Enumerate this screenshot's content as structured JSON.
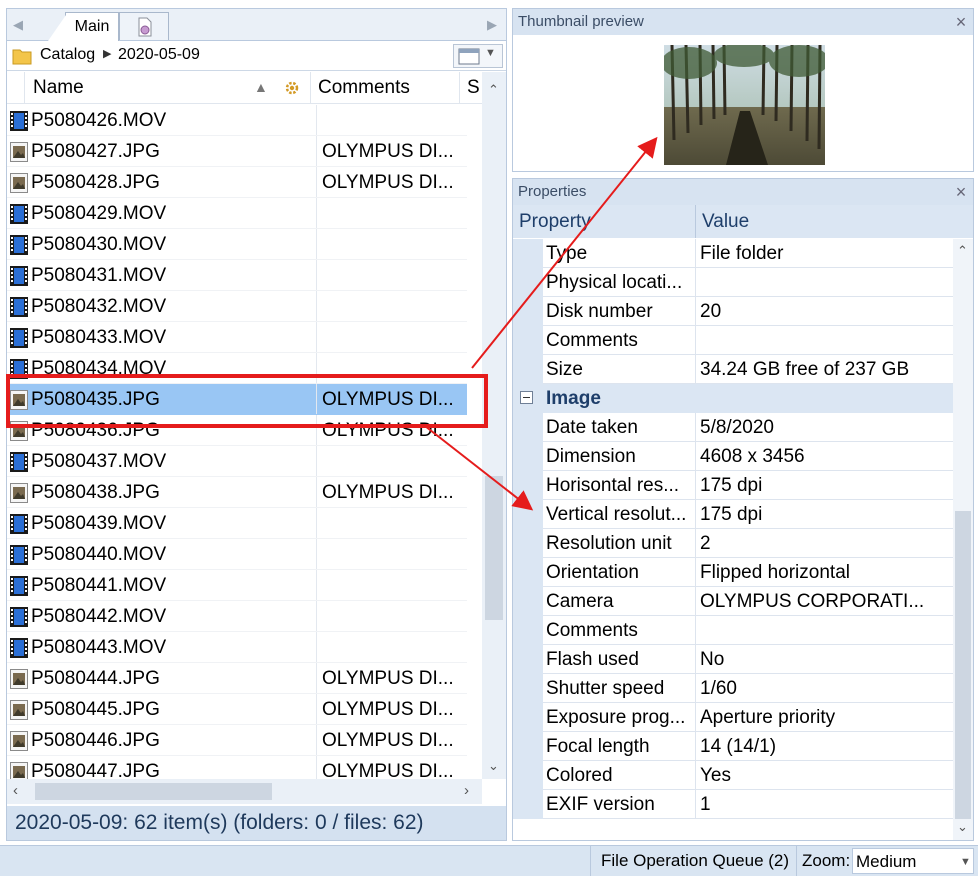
{
  "tabs": {
    "main_label": "Main"
  },
  "breadcrumb": {
    "root": "Catalog",
    "folder": "2020-05-09"
  },
  "columns": {
    "name": "Name",
    "comments": "Comments",
    "size_short": "S"
  },
  "files": [
    {
      "name": "P5080426.MOV",
      "type": "video",
      "comment": ""
    },
    {
      "name": "P5080427.JPG",
      "type": "image",
      "comment": "OLYMPUS DI..."
    },
    {
      "name": "P5080428.JPG",
      "type": "image",
      "comment": "OLYMPUS DI..."
    },
    {
      "name": "P5080429.MOV",
      "type": "video",
      "comment": ""
    },
    {
      "name": "P5080430.MOV",
      "type": "video",
      "comment": ""
    },
    {
      "name": "P5080431.MOV",
      "type": "video",
      "comment": ""
    },
    {
      "name": "P5080432.MOV",
      "type": "video",
      "comment": ""
    },
    {
      "name": "P5080433.MOV",
      "type": "video",
      "comment": ""
    },
    {
      "name": "P5080434.MOV",
      "type": "video",
      "comment": ""
    },
    {
      "name": "P5080435.JPG",
      "type": "image",
      "comment": "OLYMPUS DI...",
      "selected": true
    },
    {
      "name": "P5080436.JPG",
      "type": "image",
      "comment": "OLYMPUS DI..."
    },
    {
      "name": "P5080437.MOV",
      "type": "video",
      "comment": ""
    },
    {
      "name": "P5080438.JPG",
      "type": "image",
      "comment": "OLYMPUS DI..."
    },
    {
      "name": "P5080439.MOV",
      "type": "video",
      "comment": ""
    },
    {
      "name": "P5080440.MOV",
      "type": "video",
      "comment": ""
    },
    {
      "name": "P5080441.MOV",
      "type": "video",
      "comment": ""
    },
    {
      "name": "P5080442.MOV",
      "type": "video",
      "comment": ""
    },
    {
      "name": "P5080443.MOV",
      "type": "video",
      "comment": ""
    },
    {
      "name": "P5080444.JPG",
      "type": "image",
      "comment": "OLYMPUS DI..."
    },
    {
      "name": "P5080445.JPG",
      "type": "image",
      "comment": "OLYMPUS DI..."
    },
    {
      "name": "P5080446.JPG",
      "type": "image",
      "comment": "OLYMPUS DI..."
    },
    {
      "name": "P5080447.JPG",
      "type": "image",
      "comment": "OLYMPUS DI..."
    }
  ],
  "left_status": "2020-05-09: 62 item(s) (folders: 0 / files: 62)",
  "thumbnail": {
    "title": "Thumbnail preview"
  },
  "properties": {
    "title": "Properties",
    "header_property": "Property",
    "header_value": "Value",
    "rows": [
      {
        "key": "Type",
        "value": "File folder"
      },
      {
        "key": "Physical locati...",
        "value": ""
      },
      {
        "key": "Disk number",
        "value": "20"
      },
      {
        "key": "Comments",
        "value": ""
      },
      {
        "key": "Size",
        "value": "34.24 GB free of 237 GB"
      },
      {
        "key": "Image",
        "value": "",
        "group": true
      },
      {
        "key": "Date taken",
        "value": "5/8/2020"
      },
      {
        "key": "Dimension",
        "value": "4608 x 3456"
      },
      {
        "key": "Horisontal res...",
        "value": "175 dpi"
      },
      {
        "key": "Vertical resolut...",
        "value": "175 dpi"
      },
      {
        "key": "Resolution unit",
        "value": "2"
      },
      {
        "key": "Orientation",
        "value": "Flipped horizontal"
      },
      {
        "key": "Camera",
        "value": "OLYMPUS CORPORATI..."
      },
      {
        "key": "Comments",
        "value": ""
      },
      {
        "key": "Flash used",
        "value": "No"
      },
      {
        "key": "Shutter speed",
        "value": "1/60"
      },
      {
        "key": "Exposure prog...",
        "value": "Aperture priority"
      },
      {
        "key": "Focal length",
        "value": "14 (14/1)"
      },
      {
        "key": "Colored",
        "value": "Yes"
      },
      {
        "key": "EXIF version",
        "value": "1"
      }
    ]
  },
  "statusbar": {
    "queue": "File Operation Queue (2)",
    "zoom_label": "Zoom:",
    "zoom_value": "Medium"
  },
  "colors": {
    "selection": "#99c6f4",
    "annotation": "#e51c1c",
    "header_bg": "#dbe6f3"
  }
}
